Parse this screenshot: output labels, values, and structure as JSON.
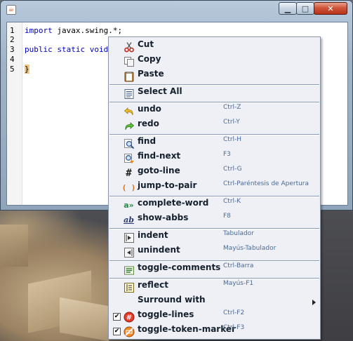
{
  "editor": {
    "lines": [
      {
        "no": "1",
        "keyword": "import",
        "rest": " javax.swing.*;"
      },
      {
        "no": "2",
        "keyword": "",
        "rest": ""
      },
      {
        "no": "3",
        "keyword": "public static void",
        "rest": ""
      },
      {
        "no": "4",
        "keyword": "",
        "rest": ""
      },
      {
        "no": "5",
        "keyword": "",
        "rest": "}"
      }
    ]
  },
  "window": {
    "icon_glyph": "☕",
    "minimize": "▁",
    "maximize": "□",
    "close": "✕"
  },
  "menu": {
    "items": [
      {
        "label": "Cut",
        "accel": "",
        "icon": "scissors-icon"
      },
      {
        "label": "Copy",
        "accel": "",
        "icon": "copy-icon"
      },
      {
        "label": "Paste",
        "accel": "",
        "icon": "clipboard-icon"
      },
      {
        "label": "Select All",
        "accel": "",
        "icon": "select-all-icon"
      },
      {
        "label": "undo",
        "accel": "Ctrl-Z",
        "icon": "undo-icon"
      },
      {
        "label": "redo",
        "accel": "Ctrl-Y",
        "icon": "redo-icon"
      },
      {
        "label": "find",
        "accel": "Ctrl-H",
        "icon": "find-icon"
      },
      {
        "label": "find-next",
        "accel": "F3",
        "icon": "find-next-icon"
      },
      {
        "label": "goto-line",
        "accel": "Ctrl-G",
        "icon": "hash-icon",
        "glyph": "#"
      },
      {
        "label": "jump-to-pair",
        "accel": "Ctrl-Paréntesis de Apertura",
        "icon": "parentheses-icon",
        "glyph": "( )"
      },
      {
        "label": "complete-word",
        "accel": "Ctrl-K",
        "icon": "complete-word-icon",
        "glyph": "a»"
      },
      {
        "label": "show-abbs",
        "accel": "F8",
        "icon": "abbreviation-icon",
        "glyph": "ab"
      },
      {
        "label": "indent",
        "accel": "Tabulador",
        "icon": "indent-icon"
      },
      {
        "label": "unindent",
        "accel": "Mayús-Tabulador",
        "icon": "unindent-icon"
      },
      {
        "label": "toggle-comments",
        "accel": "Ctrl-Barra",
        "icon": "comment-icon"
      },
      {
        "label": "reflect",
        "accel": "Mayús-F1",
        "icon": "reflect-icon"
      },
      {
        "label": "Surround with",
        "accel": "",
        "icon": "",
        "submenu": true
      },
      {
        "label": "toggle-lines",
        "accel": "Ctrl-F2",
        "icon": "line-numbers-icon",
        "checked": true,
        "check_glyph": "✔"
      },
      {
        "label": "toggle-token-marker",
        "accel": "Ctrl-F3",
        "icon": "token-marker-icon",
        "checked": true,
        "check_glyph": "✔"
      }
    ]
  },
  "colors": {
    "accelerator": "#4a6a96",
    "keyword": "#0000c0",
    "brace_highlight": "#f6c77a",
    "menu_background": "#eef0f5"
  }
}
